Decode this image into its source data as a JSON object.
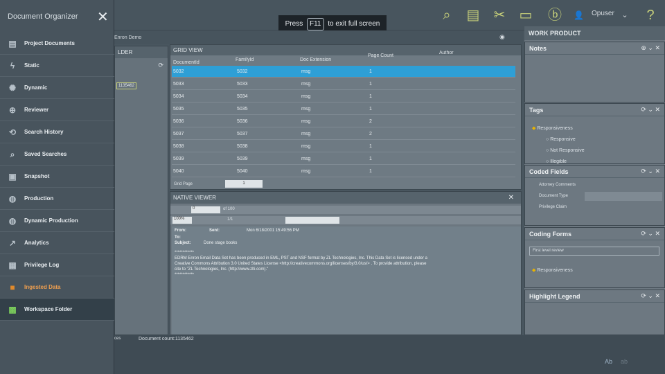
{
  "fullscreen_hint": {
    "press": "Press",
    "key": "F11",
    "rest": "to exit full screen"
  },
  "topbar": {
    "user": "Opuser"
  },
  "subbar": {
    "case": "Enron Demo"
  },
  "sidebar": {
    "title": "Document Organizer",
    "items": [
      {
        "label": "Project Documents",
        "icon": "documents-icon"
      },
      {
        "label": "Static",
        "icon": "lightning-icon"
      },
      {
        "label": "Dynamic",
        "icon": "spiral-icon"
      },
      {
        "label": "Reviewer",
        "icon": "reviewer-icon"
      },
      {
        "label": "Search History",
        "icon": "history-icon"
      },
      {
        "label": "Saved Searches",
        "icon": "saved-search-icon"
      },
      {
        "label": "Snapshot",
        "icon": "camera-icon"
      },
      {
        "label": "Production",
        "icon": "globe-icon"
      },
      {
        "label": "Dynamic Production",
        "icon": "globe-icon"
      },
      {
        "label": "Analytics",
        "icon": "chart-icon"
      },
      {
        "label": "Privilege Log",
        "icon": "log-icon"
      },
      {
        "label": "Ingested Data",
        "icon": "folder-icon"
      },
      {
        "label": "Workspace Folder",
        "icon": "workspace-icon"
      }
    ]
  },
  "left_panel": {
    "title": "LDER",
    "doc_id": "1135462"
  },
  "grid": {
    "title": "GRID VIEW",
    "columns": [
      "DocumentId",
      "FamilyId",
      "Doc Extension",
      "Page Count",
      "Author"
    ],
    "rows": [
      [
        "5032",
        "5032",
        "msg",
        "1"
      ],
      [
        "5033",
        "5033",
        "msg",
        "1"
      ],
      [
        "5034",
        "5034",
        "msg",
        "1"
      ],
      [
        "5035",
        "5035",
        "msg",
        "1"
      ],
      [
        "5036",
        "5036",
        "msg",
        "2"
      ],
      [
        "5037",
        "5037",
        "msg",
        "2"
      ],
      [
        "5038",
        "5038",
        "msg",
        "1"
      ],
      [
        "5039",
        "5039",
        "msg",
        "1"
      ],
      [
        "5040",
        "5040",
        "msg",
        "1"
      ]
    ],
    "pager": {
      "label": "Grid Page",
      "page": "1",
      "of": "/1"
    }
  },
  "viewer": {
    "title": "NATIVE VIEWER",
    "page": "0",
    "of": "of 100",
    "zoom": "100%",
    "counter": "1/1",
    "from_label": "From:",
    "sent_label": "Sent:",
    "sent": "Mon 6/18/2001 15:49:56 PM",
    "to_label": "To:",
    "subject_label": "Subject:",
    "subject": "Done stage books",
    "stars": "************",
    "body": "EDRM Enron Email Data Set has been produced in EML, PST and NSF format by ZL Technologies, Inc. This Data Set is licensed under a Creative Commons Attribution 3.0 United States License <http://creativecommons.org/licenses/by/3.0/us/> . To provide attribution, please cite to \"ZL Technologies, Inc. (http://www.zlti.com).\"",
    "stars2": "************"
  },
  "work_product": {
    "title": "WORK PRODUCT",
    "notes": "Notes",
    "tags": {
      "title": "Tags",
      "group": "Responsiveness",
      "options": [
        "Responsive",
        "Not Responsive",
        "Illegible"
      ]
    },
    "coded": {
      "title": "Coded Fields",
      "fields": [
        "Attorney Comments",
        "Document Type",
        "Privilege Claim"
      ]
    },
    "coding_forms": {
      "title": "Coding Forms",
      "select": "First level review",
      "group": "Responsiveness",
      "item": "Responsive",
      "field": "Attorney"
    },
    "legend": "Highlight Legend"
  },
  "bottom": {
    "crumb1": "ces",
    "crumb2": "Document count:1135462",
    "ab1": "Ab",
    "ab2": "ab"
  }
}
